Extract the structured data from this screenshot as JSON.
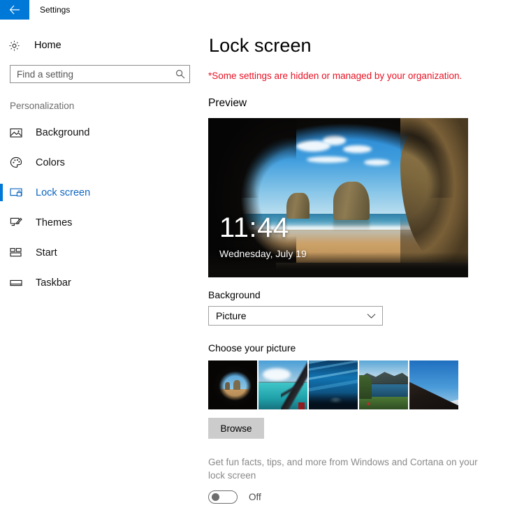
{
  "titlebar": {
    "back_icon": "back-arrow-icon",
    "title": "Settings",
    "accent_color": "#0078d7"
  },
  "sidebar": {
    "home": {
      "label": "Home",
      "icon": "gear-icon"
    },
    "search": {
      "placeholder": "Find a setting",
      "value": "",
      "icon": "search-icon"
    },
    "section_title": "Personalization",
    "items": [
      {
        "label": "Background",
        "icon": "picture-icon",
        "selected": false
      },
      {
        "label": "Colors",
        "icon": "palette-icon",
        "selected": false
      },
      {
        "label": "Lock screen",
        "icon": "lock-screen-icon",
        "selected": true
      },
      {
        "label": "Themes",
        "icon": "brush-icon",
        "selected": false
      },
      {
        "label": "Start",
        "icon": "start-tiles-icon",
        "selected": false
      },
      {
        "label": "Taskbar",
        "icon": "taskbar-icon",
        "selected": false
      }
    ],
    "selected_color": "#0c66c2"
  },
  "main": {
    "page_title": "Lock screen",
    "org_note": "*Some settings are hidden or managed by your organization.",
    "org_note_color": "#e81123",
    "preview_heading": "Preview",
    "preview": {
      "time": "11:44",
      "date": "Wednesday, July 19",
      "image_name": "cave-beach-wallpaper"
    },
    "background_field": {
      "label": "Background",
      "value": "Picture",
      "chevron_icon": "chevron-down-icon"
    },
    "choose_picture": {
      "label": "Choose your picture",
      "thumbnails": [
        {
          "name": "cave-beach-thumbnail",
          "selected": true
        },
        {
          "name": "turquoise-bay-thumbnail",
          "selected": false
        },
        {
          "name": "ice-cave-thumbnail",
          "selected": false
        },
        {
          "name": "mountain-lake-thumbnail",
          "selected": false
        },
        {
          "name": "dark-slope-thumbnail",
          "selected": false
        }
      ]
    },
    "browse_button": "Browse",
    "fun_facts": {
      "text": "Get fun facts, tips, and more from Windows and Cortana on your lock screen",
      "toggle_state": "Off"
    }
  }
}
